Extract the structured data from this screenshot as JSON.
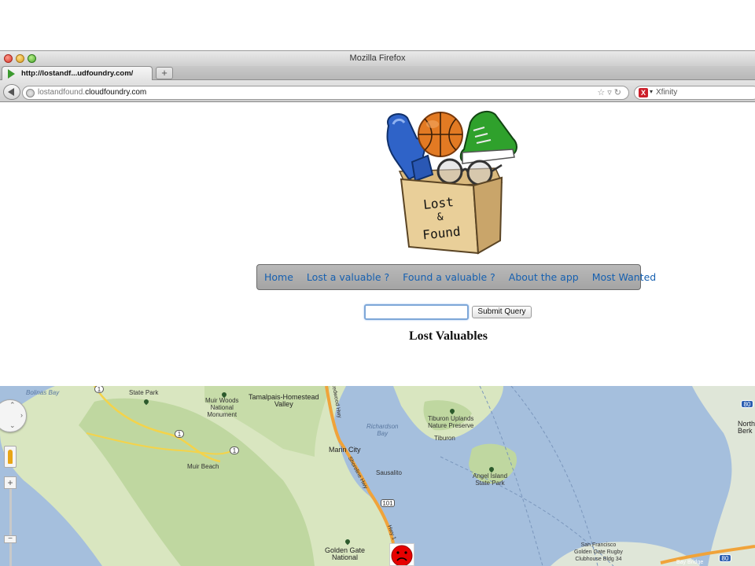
{
  "browser": {
    "window_title": "Mozilla Firefox",
    "tab_label": "http://lostandf...udfoundry.com/",
    "new_tab_label": "+",
    "url_prefix": "lostandfound.",
    "url_domain": "cloudfoundry.com",
    "search_engine_label": "X",
    "search_placeholder": "Xfinity"
  },
  "logo": {
    "line1": "Lost",
    "line2": "&",
    "line3": "Found"
  },
  "nav": {
    "items": [
      "Home",
      "Lost a valuable ?",
      "Found a valuable ?",
      "About the app",
      "Most Wanted"
    ]
  },
  "search": {
    "value": "",
    "submit_label": "Submit Query"
  },
  "heading": "Lost Valuables",
  "map": {
    "labels": {
      "bolinas_bay": "Bolinas Bay",
      "state_park": "State Park",
      "muir_woods": "Muir Woods\nNational\nMonument",
      "tamalpais": "Tamalpais-Homestead\nValley",
      "redwood_hwy": "Redwood Hwy",
      "richardson_bay": "Richardson\nBay",
      "tiburon_uplands": "Tiburon Uplands\nNature Preserve",
      "tiburon": "Tiburon",
      "marin_city": "Marin City",
      "sausalito": "Sausalito",
      "shoreline_hwy": "Shoreline Hwy",
      "muir_beach": "Muir Beach",
      "angel_island": "Angel Island\nState Park",
      "golden_gate": "Golden Gate\nNational",
      "sf_rugby": "San Francisco\nGolden Gate Rugby\nClubhouse Bldg 34",
      "bay_bridge": "Bay Bridge",
      "north_berk": "North\nBerk",
      "hwy1_a": "1",
      "hwy1_b": "1",
      "hwy1_c": "1",
      "hwy101": "101",
      "hwy80": "80",
      "hwy80b": "80",
      "hwy1_d": "Hwy 1"
    }
  }
}
